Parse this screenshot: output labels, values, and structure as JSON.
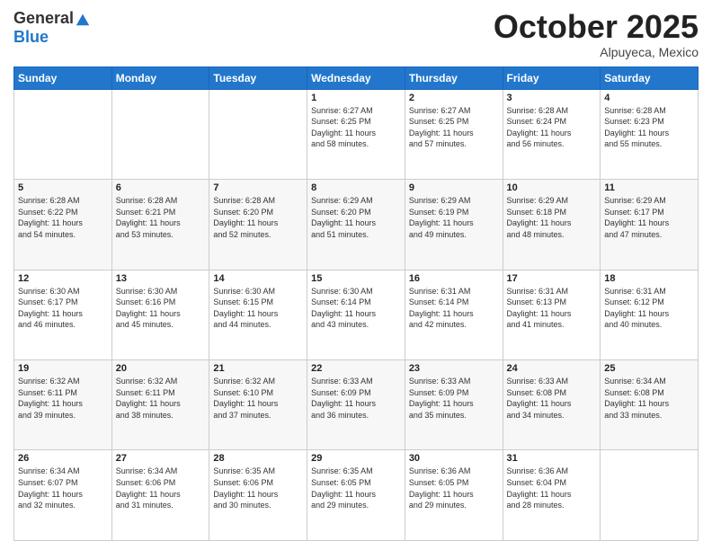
{
  "header": {
    "logo_general": "General",
    "logo_blue": "Blue",
    "month_title": "October 2025",
    "location": "Alpuyeca, Mexico"
  },
  "weekdays": [
    "Sunday",
    "Monday",
    "Tuesday",
    "Wednesday",
    "Thursday",
    "Friday",
    "Saturday"
  ],
  "weeks": [
    [
      {
        "day": "",
        "info": ""
      },
      {
        "day": "",
        "info": ""
      },
      {
        "day": "",
        "info": ""
      },
      {
        "day": "1",
        "info": "Sunrise: 6:27 AM\nSunset: 6:25 PM\nDaylight: 11 hours\nand 58 minutes."
      },
      {
        "day": "2",
        "info": "Sunrise: 6:27 AM\nSunset: 6:25 PM\nDaylight: 11 hours\nand 57 minutes."
      },
      {
        "day": "3",
        "info": "Sunrise: 6:28 AM\nSunset: 6:24 PM\nDaylight: 11 hours\nand 56 minutes."
      },
      {
        "day": "4",
        "info": "Sunrise: 6:28 AM\nSunset: 6:23 PM\nDaylight: 11 hours\nand 55 minutes."
      }
    ],
    [
      {
        "day": "5",
        "info": "Sunrise: 6:28 AM\nSunset: 6:22 PM\nDaylight: 11 hours\nand 54 minutes."
      },
      {
        "day": "6",
        "info": "Sunrise: 6:28 AM\nSunset: 6:21 PM\nDaylight: 11 hours\nand 53 minutes."
      },
      {
        "day": "7",
        "info": "Sunrise: 6:28 AM\nSunset: 6:20 PM\nDaylight: 11 hours\nand 52 minutes."
      },
      {
        "day": "8",
        "info": "Sunrise: 6:29 AM\nSunset: 6:20 PM\nDaylight: 11 hours\nand 51 minutes."
      },
      {
        "day": "9",
        "info": "Sunrise: 6:29 AM\nSunset: 6:19 PM\nDaylight: 11 hours\nand 49 minutes."
      },
      {
        "day": "10",
        "info": "Sunrise: 6:29 AM\nSunset: 6:18 PM\nDaylight: 11 hours\nand 48 minutes."
      },
      {
        "day": "11",
        "info": "Sunrise: 6:29 AM\nSunset: 6:17 PM\nDaylight: 11 hours\nand 47 minutes."
      }
    ],
    [
      {
        "day": "12",
        "info": "Sunrise: 6:30 AM\nSunset: 6:17 PM\nDaylight: 11 hours\nand 46 minutes."
      },
      {
        "day": "13",
        "info": "Sunrise: 6:30 AM\nSunset: 6:16 PM\nDaylight: 11 hours\nand 45 minutes."
      },
      {
        "day": "14",
        "info": "Sunrise: 6:30 AM\nSunset: 6:15 PM\nDaylight: 11 hours\nand 44 minutes."
      },
      {
        "day": "15",
        "info": "Sunrise: 6:30 AM\nSunset: 6:14 PM\nDaylight: 11 hours\nand 43 minutes."
      },
      {
        "day": "16",
        "info": "Sunrise: 6:31 AM\nSunset: 6:14 PM\nDaylight: 11 hours\nand 42 minutes."
      },
      {
        "day": "17",
        "info": "Sunrise: 6:31 AM\nSunset: 6:13 PM\nDaylight: 11 hours\nand 41 minutes."
      },
      {
        "day": "18",
        "info": "Sunrise: 6:31 AM\nSunset: 6:12 PM\nDaylight: 11 hours\nand 40 minutes."
      }
    ],
    [
      {
        "day": "19",
        "info": "Sunrise: 6:32 AM\nSunset: 6:11 PM\nDaylight: 11 hours\nand 39 minutes."
      },
      {
        "day": "20",
        "info": "Sunrise: 6:32 AM\nSunset: 6:11 PM\nDaylight: 11 hours\nand 38 minutes."
      },
      {
        "day": "21",
        "info": "Sunrise: 6:32 AM\nSunset: 6:10 PM\nDaylight: 11 hours\nand 37 minutes."
      },
      {
        "day": "22",
        "info": "Sunrise: 6:33 AM\nSunset: 6:09 PM\nDaylight: 11 hours\nand 36 minutes."
      },
      {
        "day": "23",
        "info": "Sunrise: 6:33 AM\nSunset: 6:09 PM\nDaylight: 11 hours\nand 35 minutes."
      },
      {
        "day": "24",
        "info": "Sunrise: 6:33 AM\nSunset: 6:08 PM\nDaylight: 11 hours\nand 34 minutes."
      },
      {
        "day": "25",
        "info": "Sunrise: 6:34 AM\nSunset: 6:08 PM\nDaylight: 11 hours\nand 33 minutes."
      }
    ],
    [
      {
        "day": "26",
        "info": "Sunrise: 6:34 AM\nSunset: 6:07 PM\nDaylight: 11 hours\nand 32 minutes."
      },
      {
        "day": "27",
        "info": "Sunrise: 6:34 AM\nSunset: 6:06 PM\nDaylight: 11 hours\nand 31 minutes."
      },
      {
        "day": "28",
        "info": "Sunrise: 6:35 AM\nSunset: 6:06 PM\nDaylight: 11 hours\nand 30 minutes."
      },
      {
        "day": "29",
        "info": "Sunrise: 6:35 AM\nSunset: 6:05 PM\nDaylight: 11 hours\nand 29 minutes."
      },
      {
        "day": "30",
        "info": "Sunrise: 6:36 AM\nSunset: 6:05 PM\nDaylight: 11 hours\nand 29 minutes."
      },
      {
        "day": "31",
        "info": "Sunrise: 6:36 AM\nSunset: 6:04 PM\nDaylight: 11 hours\nand 28 minutes."
      },
      {
        "day": "",
        "info": ""
      }
    ]
  ]
}
